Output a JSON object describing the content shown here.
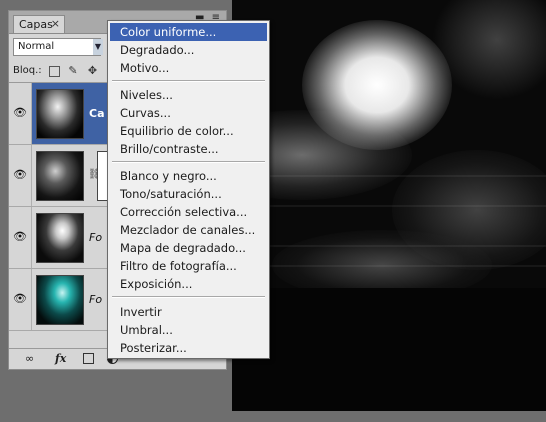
{
  "panel": {
    "tab_label": "Capas",
    "tab_close": "×",
    "window_controls": "▬ ≡",
    "blend_mode": "Normal",
    "lock_label": "Bloq.:",
    "layers": [
      {
        "name": "Ca",
        "visible_icon": "eye-icon",
        "selected": true
      },
      {
        "name": "",
        "visible_icon": "eye-icon",
        "selected": false
      },
      {
        "name": "Fo",
        "visible_icon": "eye-icon",
        "selected": false
      },
      {
        "name": "Fo",
        "visible_icon": "eye-icon",
        "selected": false
      }
    ],
    "bottom_icons": [
      "link-layers-icon",
      "fx-icon",
      "add-mask-icon",
      "adjustment-layer-icon"
    ]
  },
  "menu": {
    "items": [
      "Color uniforme...",
      "Degradado...",
      "Motivo...",
      "Niveles...",
      "Curvas...",
      "Equilibrio de color...",
      "Brillo/contraste...",
      "Blanco y negro...",
      "Tono/saturación...",
      "Corrección selectiva...",
      "Mezclador de canales...",
      "Mapa de degradado...",
      "Filtro de fotografía...",
      "Exposición...",
      "Invertir",
      "Umbral...",
      "Posterizar..."
    ],
    "highlighted": "Color uniforme..."
  },
  "colors": {
    "highlight": "#3c62b2",
    "selected_layer": "#3f62a4",
    "panel_bg": "#d6d6d6",
    "menu_bg": "#f0f0f0",
    "canvas_bg": "#090909"
  },
  "icons": {
    "eye": "👁",
    "chain": "⛓",
    "fx": "fx",
    "link": "∞",
    "brush": "✎",
    "move": "✥"
  }
}
